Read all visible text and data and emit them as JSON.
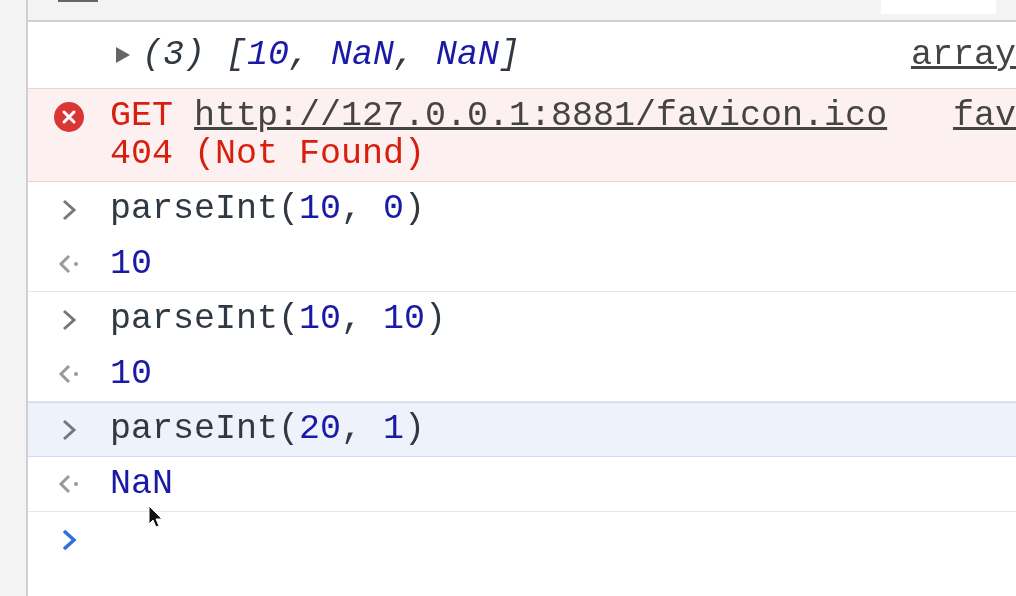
{
  "log_message": {
    "expanded": false,
    "tokens": [
      {
        "text": "(3) ",
        "color": "#303942"
      },
      {
        "text": "[",
        "color": "#303942"
      },
      {
        "text": "10",
        "color": "#1a1aa6"
      },
      {
        "text": ", ",
        "color": "#303942"
      },
      {
        "text": "NaN",
        "color": "#1a1aa6"
      },
      {
        "text": ", ",
        "color": "#303942"
      },
      {
        "text": "NaN",
        "color": "#1a1aa6"
      },
      {
        "text": "]",
        "color": "#303942"
      }
    ],
    "source": "array"
  },
  "error_message": {
    "method": "GET",
    "url": "http://127.0.0.1:8881/favicon.ico",
    "status": "404 (Not Found)",
    "source": "fav"
  },
  "entries": [
    {
      "kind": "input",
      "selected": false,
      "tokens": [
        {
          "text": "parseInt(",
          "color": "#303942"
        },
        {
          "text": "10",
          "color": "#1a1aa6"
        },
        {
          "text": ", ",
          "color": "#303942"
        },
        {
          "text": "0",
          "color": "#1a1aa6"
        },
        {
          "text": ")",
          "color": "#303942"
        }
      ]
    },
    {
      "kind": "output",
      "selected": false,
      "tokens": [
        {
          "text": "10",
          "color": "#1a1aa6"
        }
      ]
    },
    {
      "kind": "input",
      "selected": false,
      "tokens": [
        {
          "text": "parseInt(",
          "color": "#303942"
        },
        {
          "text": "10",
          "color": "#1a1aa6"
        },
        {
          "text": ", ",
          "color": "#303942"
        },
        {
          "text": "10",
          "color": "#1a1aa6"
        },
        {
          "text": ")",
          "color": "#303942"
        }
      ]
    },
    {
      "kind": "output",
      "selected": false,
      "tokens": [
        {
          "text": "10",
          "color": "#1a1aa6"
        }
      ]
    },
    {
      "kind": "input",
      "selected": true,
      "tokens": [
        {
          "text": "parseInt(",
          "color": "#303942"
        },
        {
          "text": "20",
          "color": "#1a1aa6"
        },
        {
          "text": ", ",
          "color": "#303942"
        },
        {
          "text": "1",
          "color": "#1a1aa6"
        },
        {
          "text": ")",
          "color": "#303942"
        }
      ]
    },
    {
      "kind": "output",
      "selected": false,
      "tokens": [
        {
          "text": "NaN",
          "color": "#1a1aa6"
        }
      ]
    },
    {
      "kind": "prompt",
      "selected": false
    }
  ]
}
